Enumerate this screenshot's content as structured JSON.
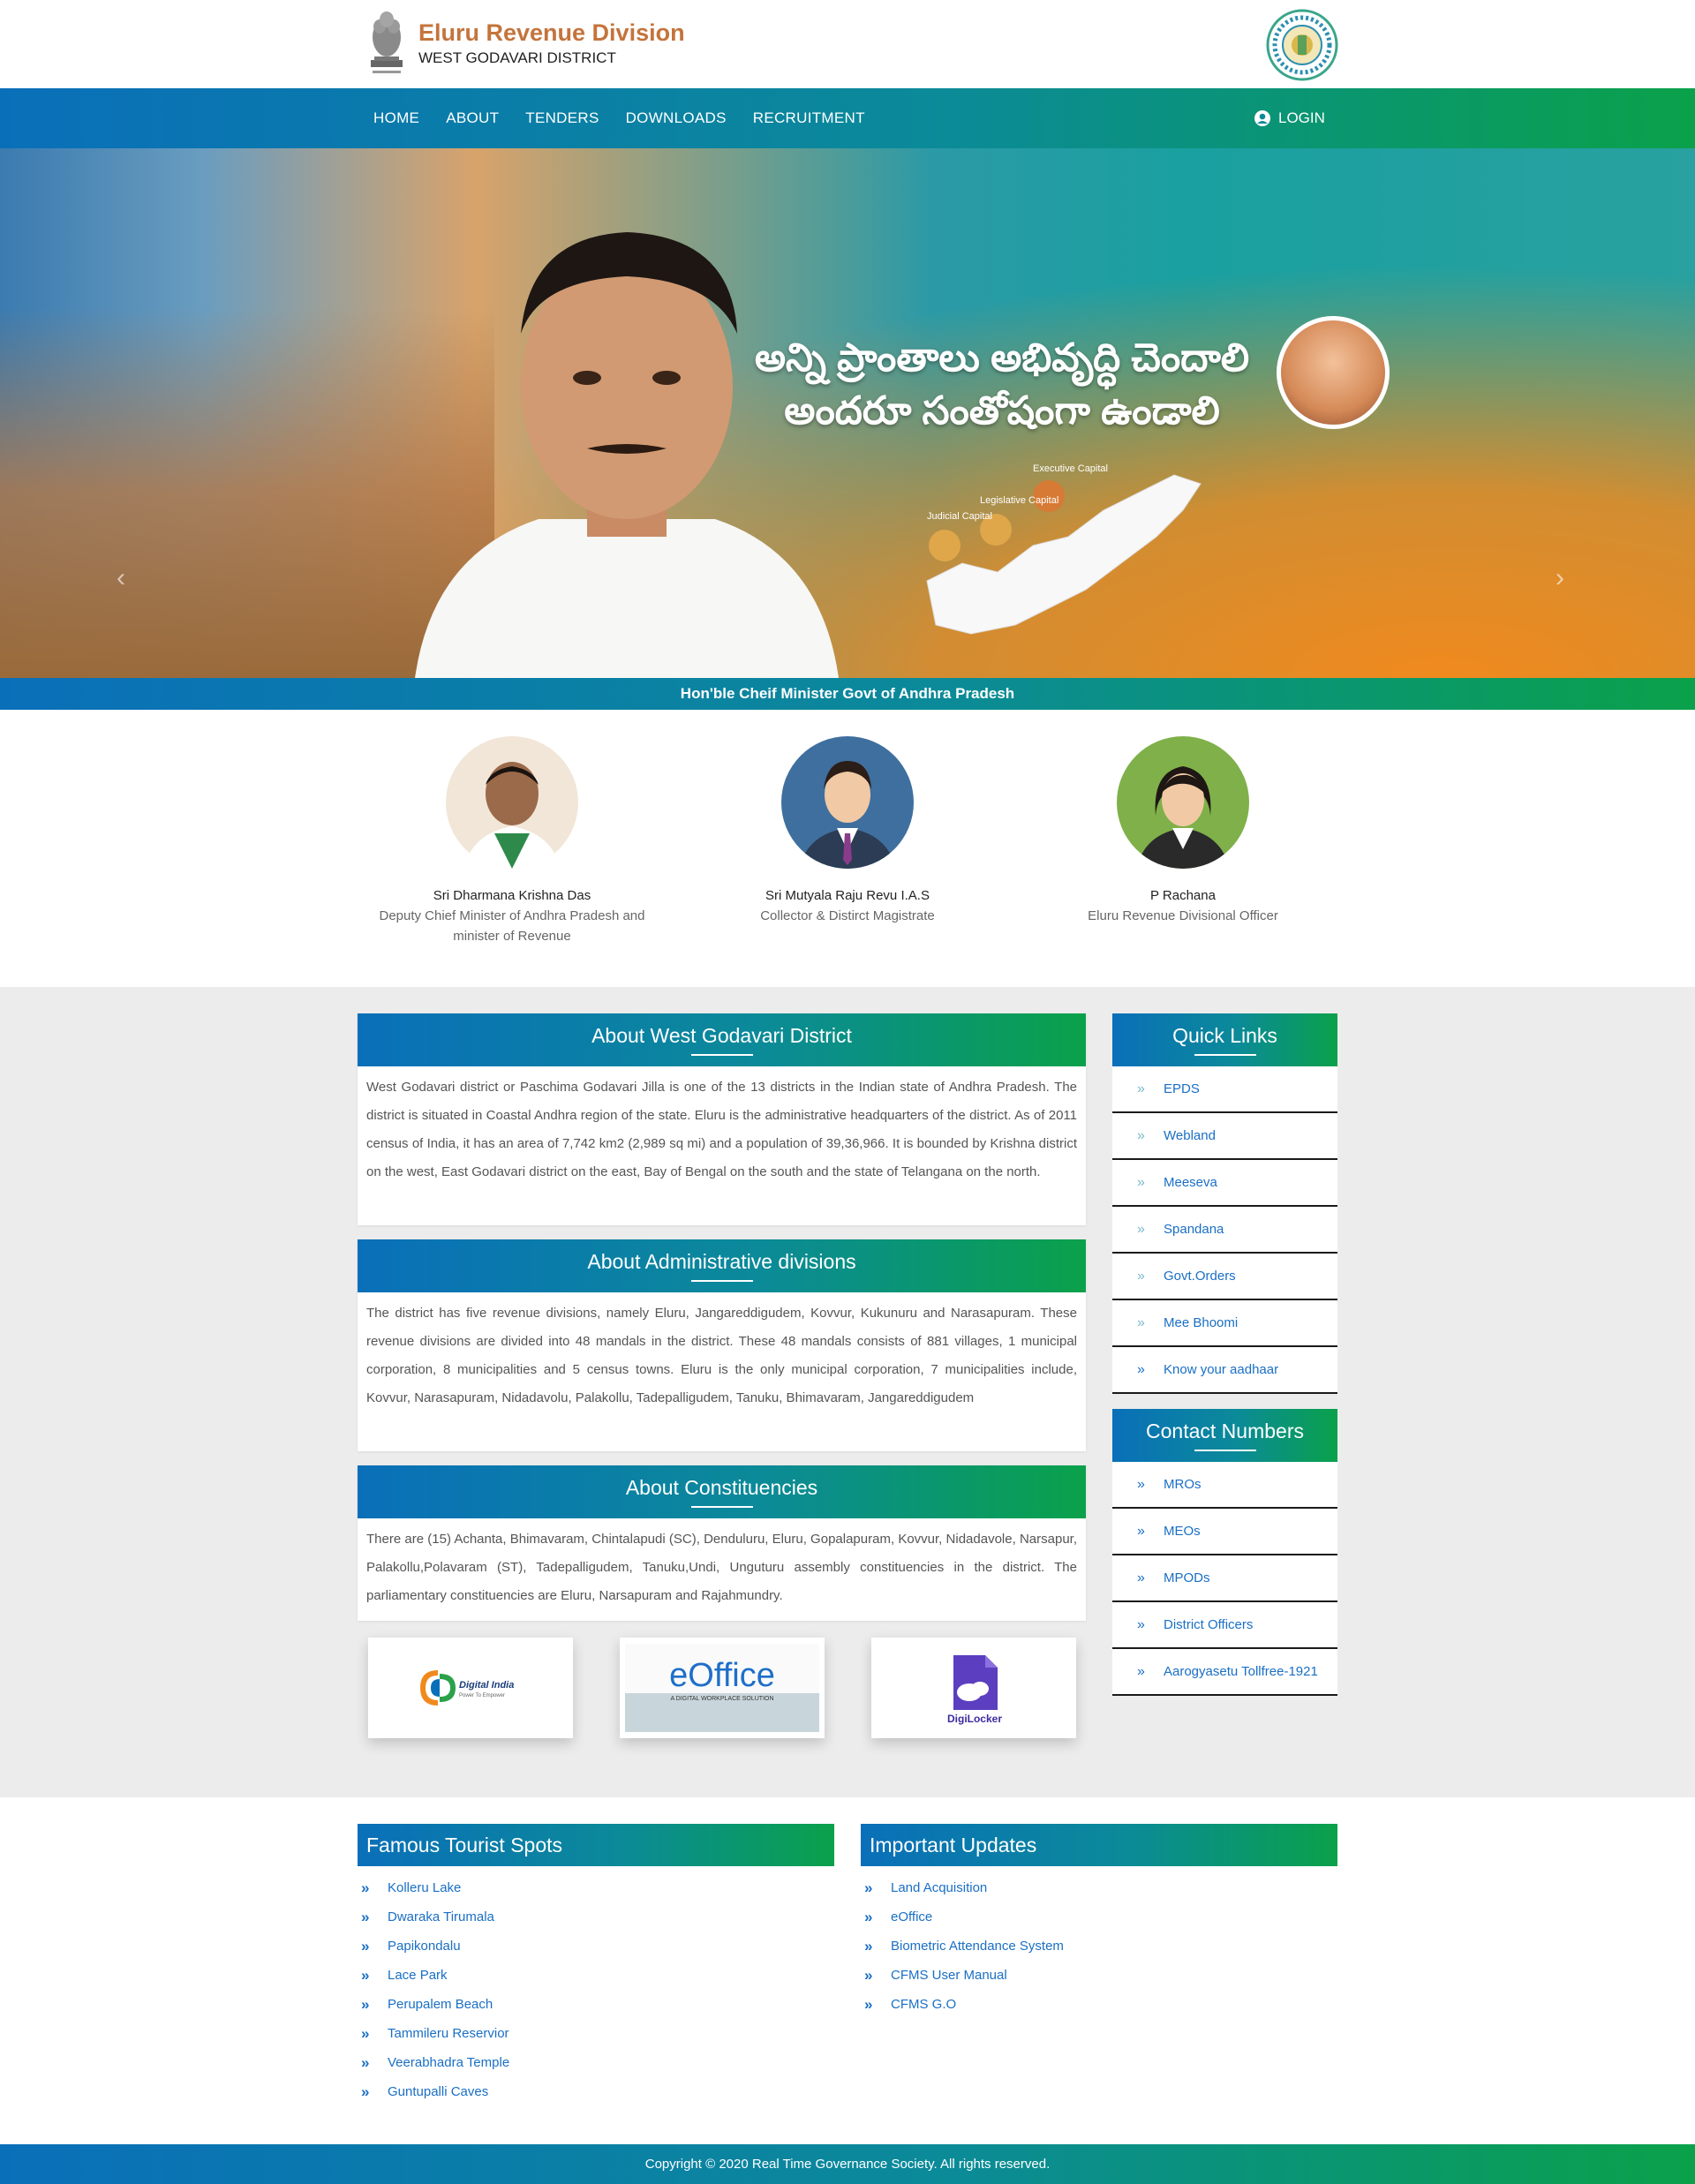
{
  "header": {
    "title": "Eluru Revenue Division",
    "subtitle": "WEST GODAVARI DISTRICT"
  },
  "nav": {
    "items": [
      {
        "label": "HOME"
      },
      {
        "label": "ABOUT"
      },
      {
        "label": "TENDERS"
      },
      {
        "label": "DOWNLOADS"
      },
      {
        "label": "RECRUITMENT"
      }
    ],
    "login": "LOGIN"
  },
  "hero": {
    "line1": "అన్ని ప్రాంతాలు అభివృద్ధి చెందాలి",
    "line2": "అందరూ సంతోషంగా ఉండాలి",
    "map_labels": [
      "Judicial Capital",
      "Legislative Capital",
      "Executive Capital"
    ],
    "caption": "Hon'ble Cheif Minister Govt of Andhra Pradesh"
  },
  "officials": [
    {
      "name": "Sri Dharmana Krishna Das",
      "role1": "Deputy Chief Minister of Andhra Pradesh and",
      "role2": "minister of Revenue"
    },
    {
      "name": "Sri Mutyala Raju Revu I.A.S",
      "role1": "Collector & Distirct Magistrate",
      "role2": ""
    },
    {
      "name": "P Rachana",
      "role1": "Eluru Revenue Divisional Officer",
      "role2": ""
    }
  ],
  "about": {
    "district": {
      "title": "About West Godavari District",
      "text": "West Godavari district or Paschima Godavari Jilla is one of the 13 districts in the Indian state of Andhra Pradesh. The district is situated in Coastal Andhra region of the state. Eluru is the administrative headquarters of the district. As of 2011 census of India, it has an area of 7,742 km2 (2,989 sq mi) and a population of 39,36,966. It is bounded by Krishna district on the west, East Godavari district on the east, Bay of Bengal on the south and the state of Telangana on the north."
    },
    "admin": {
      "title": "About Administrative divisions",
      "text": "The district has five revenue divisions, namely Eluru, Jangareddigudem, Kovvur, Kukunuru and Narasapuram. These revenue divisions are divided into 48 mandals in the district. These 48 mandals consists of 881 villages, 1 municipal corporation, 8 municipalities and 5 census towns. Eluru is the only municipal corporation, 7 municipalities include, Kovvur, Narasapuram, Nidadavolu, Palakollu, Tadepalligudem, Tanuku, Bhimavaram, Jangareddigudem"
    },
    "constituencies": {
      "title": "About Constituencies",
      "text": "There are (15) Achanta, Bhimavaram, Chintalapudi (SC), Denduluru, Eluru, Gopalapuram, Kovvur, Nidadavole, Narsapur, Palakollu,Polavaram (ST), Tadepalligudem, Tanuku,Undi, Unguturu assembly constituencies in the district. The parliamentary constituencies are Eluru, Narsapuram and Rajahmundry."
    }
  },
  "quick_links": {
    "title": "Quick Links",
    "items": [
      {
        "label": "EPDS"
      },
      {
        "label": "Webland"
      },
      {
        "label": "Meeseva"
      },
      {
        "label": "Spandana"
      },
      {
        "label": "Govt.Orders"
      },
      {
        "label": "Mee Bhoomi"
      },
      {
        "label": "Know your aadhaar"
      }
    ]
  },
  "contact_numbers": {
    "title": "Contact Numbers",
    "items": [
      {
        "label": "MROs"
      },
      {
        "label": "MEOs"
      },
      {
        "label": "MPODs"
      },
      {
        "label": "District Officers"
      },
      {
        "label": "Aarogyasetu Tollfree-1921"
      }
    ]
  },
  "logos": {
    "digital_india": "Digital India",
    "digital_india_tag": "Power To Empower",
    "eoffice": "eOffice",
    "eoffice_tag": "A DIGITAL WORKPLACE SOLUTION",
    "digilocker": "DigiLocker"
  },
  "tourist": {
    "title": "Famous Tourist Spots",
    "items": [
      {
        "label": "Kolleru Lake"
      },
      {
        "label": "Dwaraka Tirumala"
      },
      {
        "label": "Papikondalu"
      },
      {
        "label": "Lace Park"
      },
      {
        "label": "Perupalem Beach"
      },
      {
        "label": "Tammileru Reservior"
      },
      {
        "label": "Veerabhadra Temple"
      },
      {
        "label": "Guntupalli Caves"
      }
    ]
  },
  "updates": {
    "title": "Important Updates",
    "items": [
      {
        "label": "Land Acquisition"
      },
      {
        "label": "eOffice"
      },
      {
        "label": "Biometric Attendance System"
      },
      {
        "label": "CFMS User Manual"
      },
      {
        "label": "CFMS G.O"
      }
    ]
  },
  "footer": {
    "copyright": "Copyright © 2020 Real Time Governance Society. All rights reserved."
  },
  "colors": {
    "gradient_start": "#0a6fb9",
    "gradient_end": "#0aa14a",
    "brand_title": "#c4743c",
    "link": "#1a6fc4",
    "section_bg": "#ececec"
  }
}
